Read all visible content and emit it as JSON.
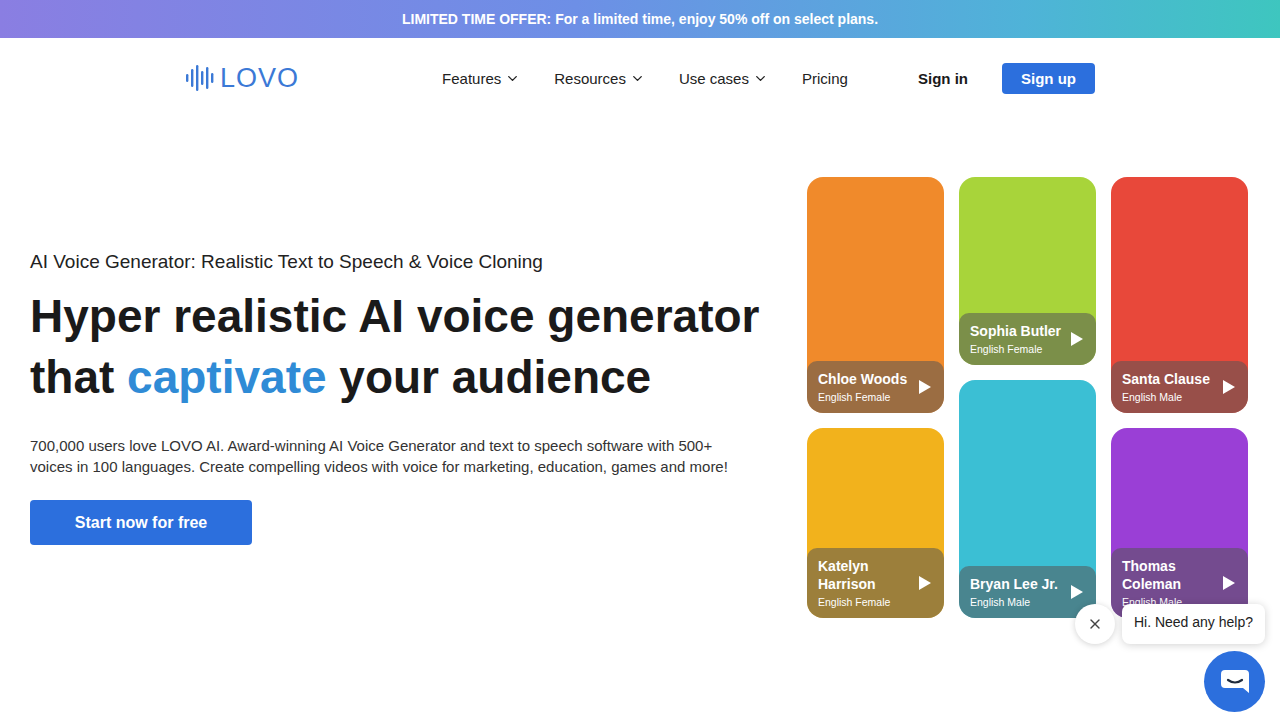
{
  "banner": {
    "text": "LIMITED TIME OFFER: For a limited time, enjoy 50% off on select plans."
  },
  "logo": {
    "text": "LOVO"
  },
  "nav": {
    "items": [
      {
        "label": "Features",
        "has_menu": true
      },
      {
        "label": "Resources",
        "has_menu": true
      },
      {
        "label": "Use cases",
        "has_menu": true
      },
      {
        "label": "Pricing",
        "has_menu": false
      }
    ]
  },
  "auth": {
    "sign_in": "Sign in",
    "sign_up": "Sign up"
  },
  "hero": {
    "eyebrow": "AI Voice Generator: Realistic Text to Speech & Voice Cloning",
    "headline": [
      [
        {
          "text": "Hyper realistic AI voice generator",
          "highlight": false
        }
      ],
      [
        {
          "text": "that ",
          "highlight": false
        },
        {
          "text": "captivate",
          "highlight": true
        },
        {
          "text": " your audience",
          "highlight": false
        }
      ]
    ],
    "description": "700,000 users love LOVO AI. Award-winning AI Voice Generator and text to speech software with 500+ voices in 100 languages. Create compelling videos with voice for marketing, education, games and more!",
    "cta": "Start now for free"
  },
  "voices": [
    [
      {
        "name": "Chloe Woods",
        "language": "English Female",
        "color": "#f08a2b"
      },
      {
        "name": "Katelyn Harrison",
        "language": "English Female",
        "color": "#f2b21c"
      }
    ],
    [
      {
        "name": "Sophia Butler",
        "language": "English Female",
        "color": "#a8d43a"
      },
      {
        "name": "Bryan Lee Jr.",
        "language": "English Male",
        "color": "#3bbfd4"
      }
    ],
    [
      {
        "name": "Santa Clause",
        "language": "English Male",
        "color": "#e8483a"
      },
      {
        "name": "Thomas Coleman",
        "language": "English Male",
        "color": "#9a3fd6"
      }
    ]
  ],
  "chat": {
    "greeting": "Hi. Need any help?"
  }
}
